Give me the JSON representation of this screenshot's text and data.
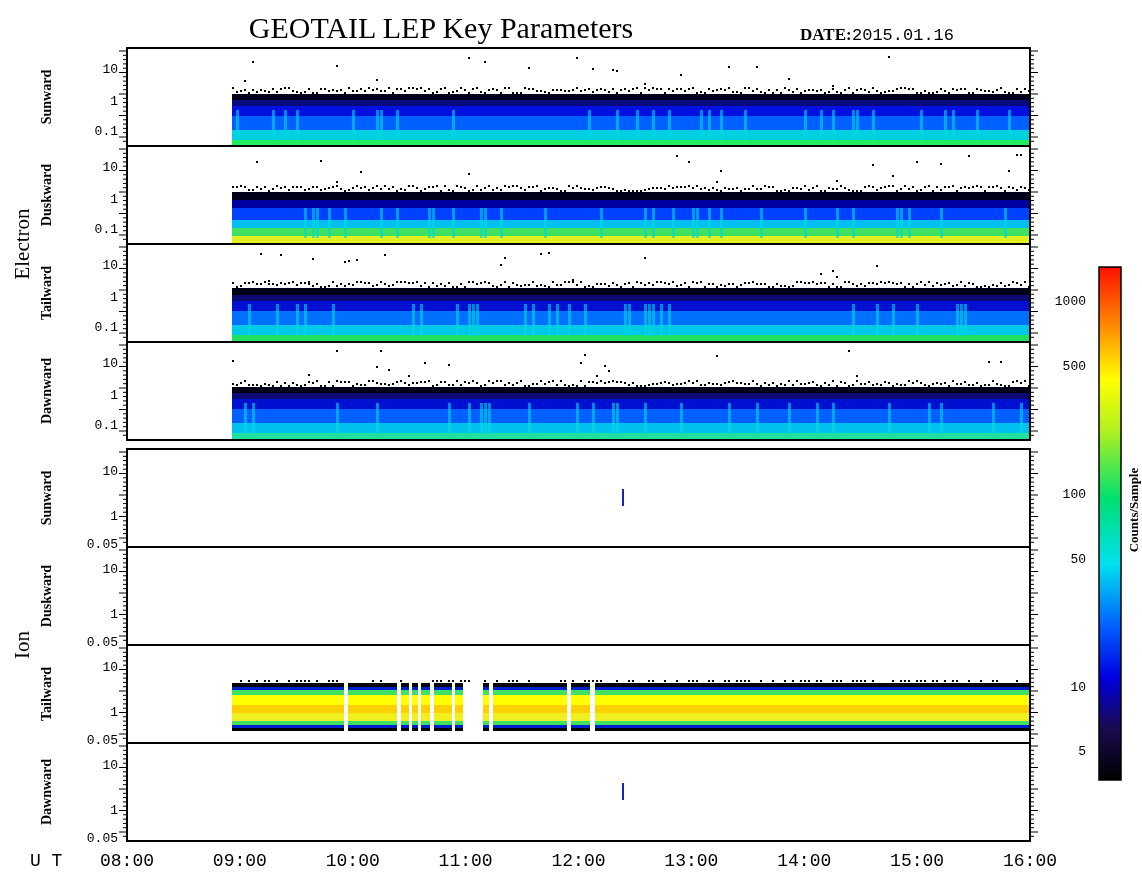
{
  "title": "GEOTAIL LEP Key Parameters",
  "date_label": "DATE:",
  "date": "2015.01.16",
  "groups": [
    {
      "name": "Electron",
      "panels": [
        {
          "label": "Sunward",
          "yticks": [
            "10",
            "1",
            "0.1"
          ]
        },
        {
          "label": "Duskward",
          "yticks": [
            "10",
            "1",
            "0.1"
          ]
        },
        {
          "label": "Tailward",
          "yticks": [
            "10",
            "1",
            "0.1"
          ]
        },
        {
          "label": "Dawnward",
          "yticks": [
            "10",
            "1",
            "0.1"
          ]
        }
      ]
    },
    {
      "name": "Ion",
      "panels": [
        {
          "label": "Sunward",
          "yticks": [
            "10",
            "1",
            "0.05"
          ]
        },
        {
          "label": "Duskward",
          "yticks": [
            "10",
            "1",
            "0.05"
          ]
        },
        {
          "label": "Tailward",
          "yticks": [
            "10",
            "1",
            "0.05"
          ]
        },
        {
          "label": "Dawnward",
          "yticks": [
            "10",
            "1",
            "0.05"
          ]
        }
      ]
    }
  ],
  "colorbar": {
    "label": "Counts/Sample",
    "ticks": [
      "1000",
      "500",
      "100",
      "50",
      "10",
      "5"
    ]
  },
  "x_axis": {
    "label": "U T",
    "ticks": [
      "08:00",
      "09:00",
      "10:00",
      "11:00",
      "12:00",
      "13:00",
      "14:00",
      "15:00",
      "16:00"
    ]
  }
}
